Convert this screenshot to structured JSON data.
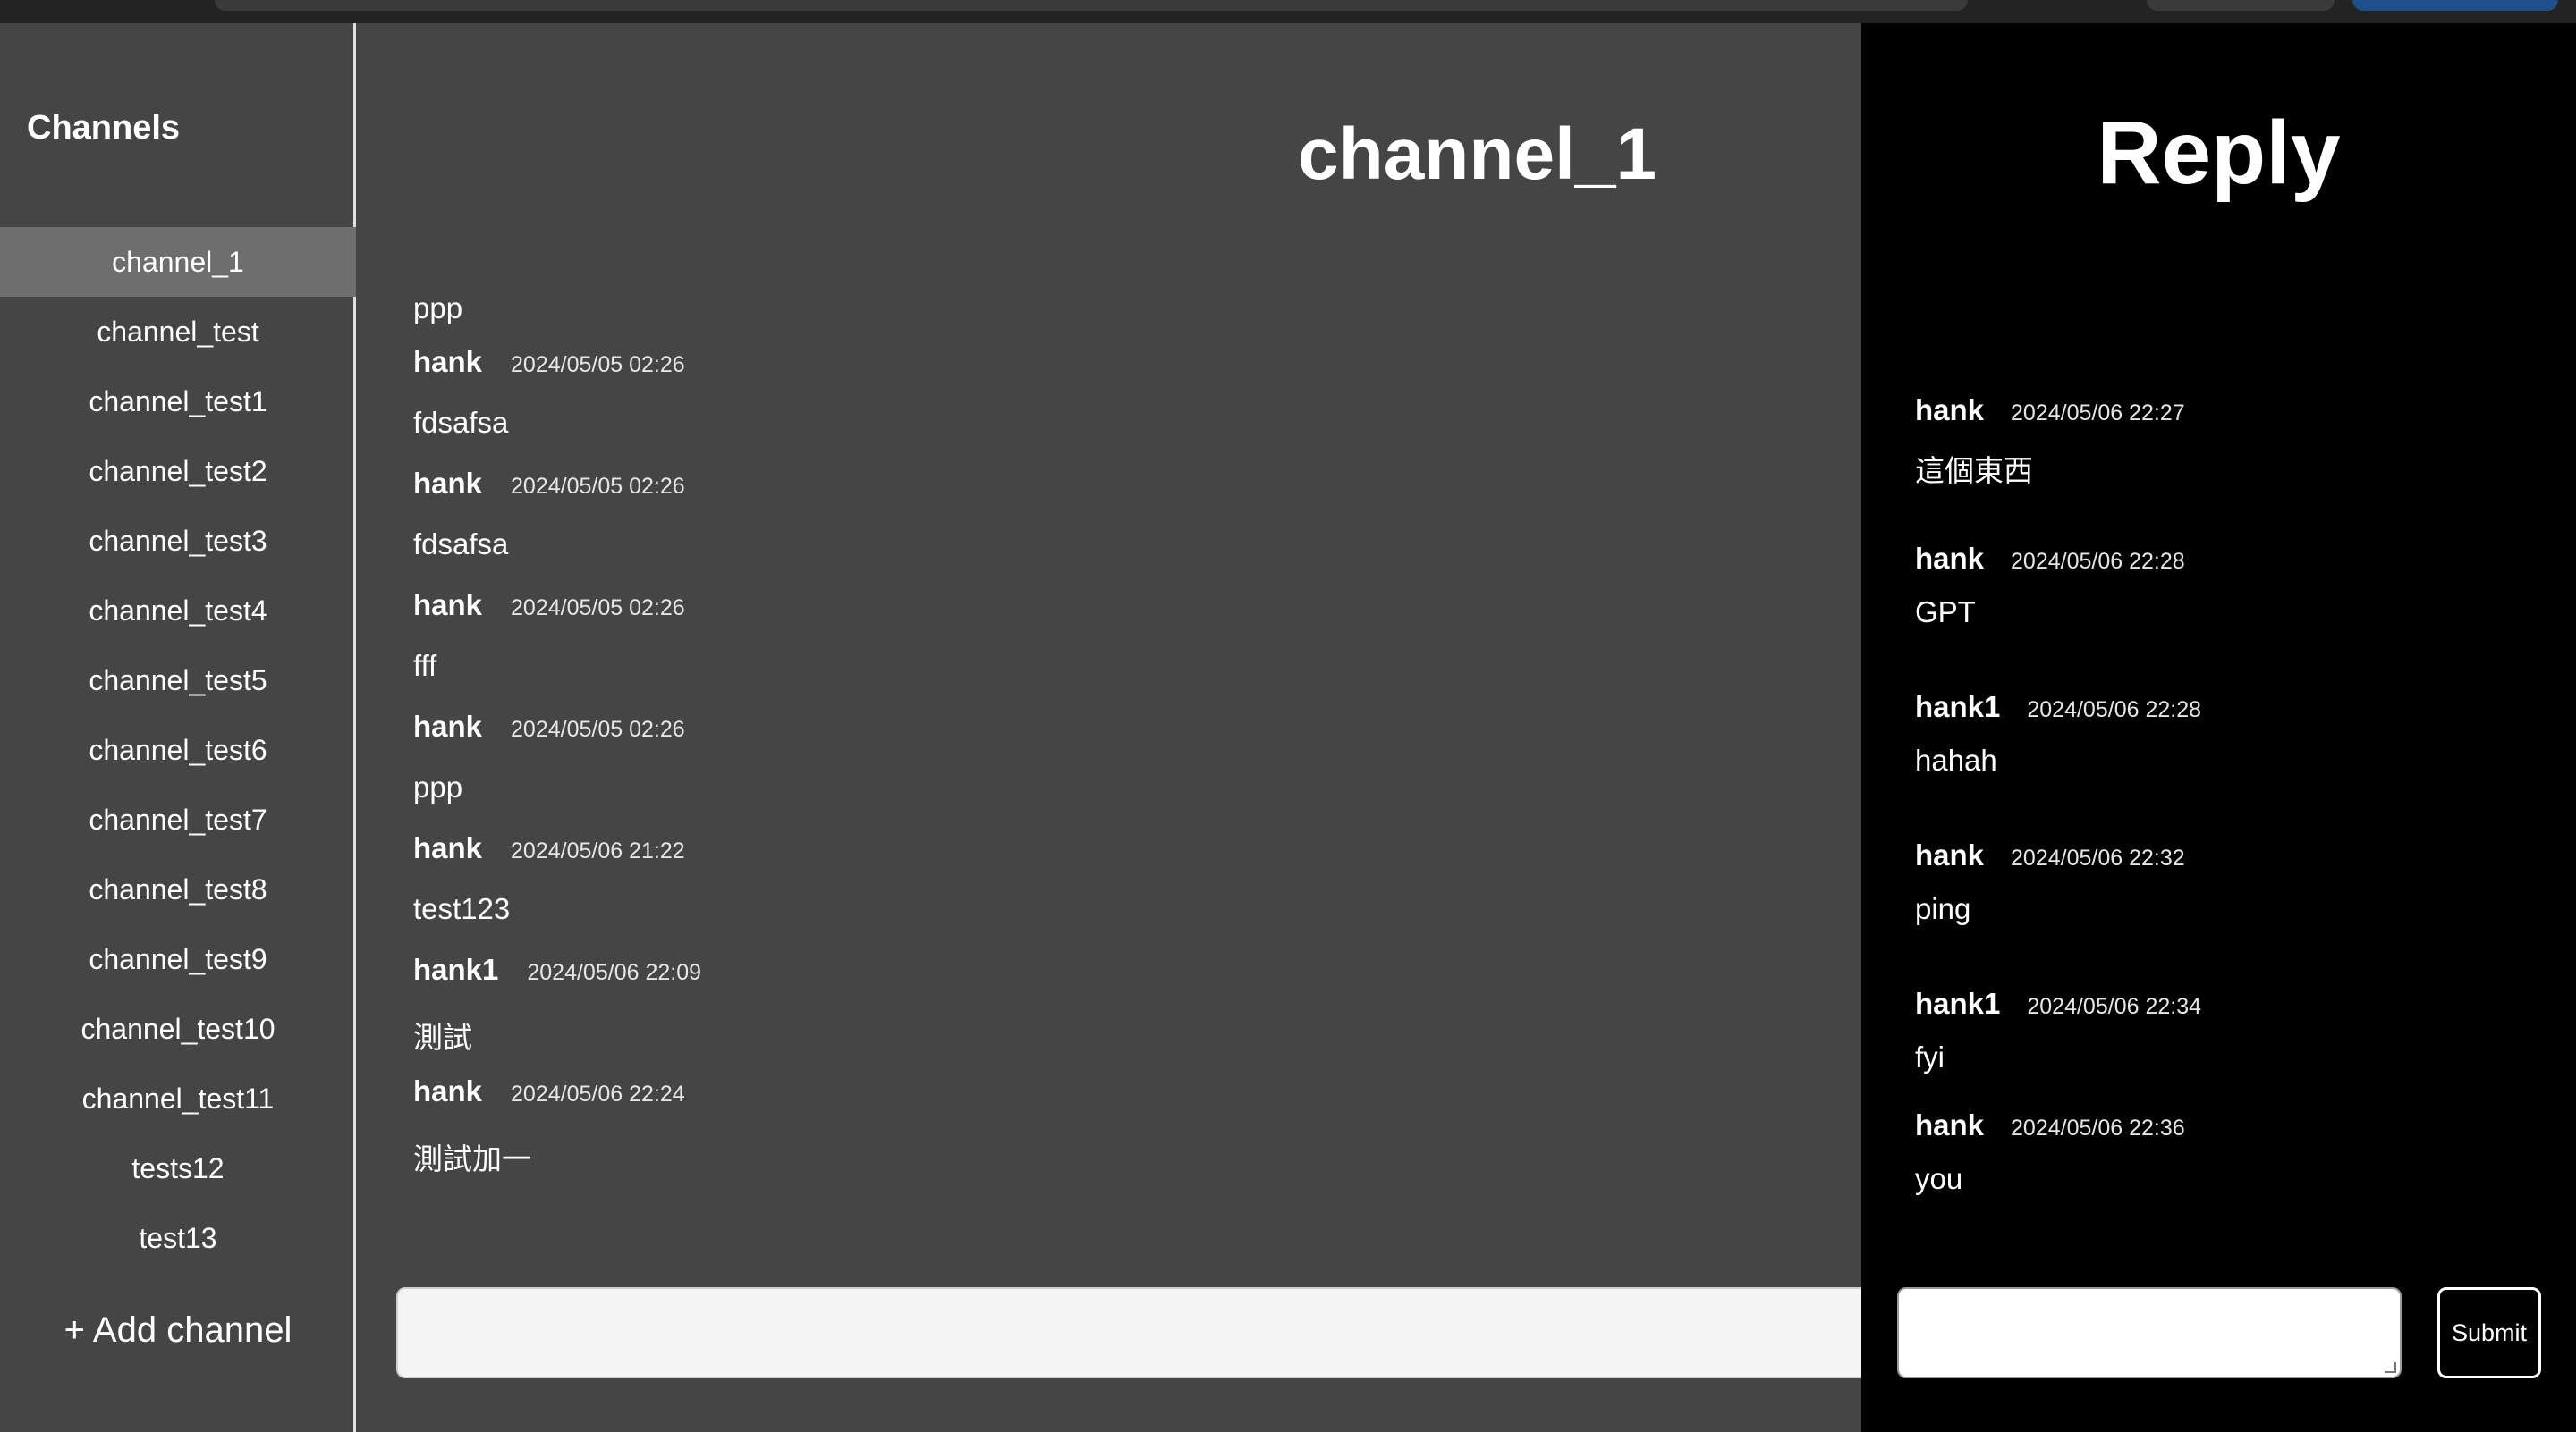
{
  "sidebar": {
    "title": "Channels",
    "add_label": "+ Add channel",
    "channels": [
      {
        "label": "channel_1",
        "active": true
      },
      {
        "label": "channel_test"
      },
      {
        "label": "channel_test1"
      },
      {
        "label": "channel_test2"
      },
      {
        "label": "channel_test3"
      },
      {
        "label": "channel_test4"
      },
      {
        "label": "channel_test5"
      },
      {
        "label": "channel_test6"
      },
      {
        "label": "channel_test7"
      },
      {
        "label": "channel_test8"
      },
      {
        "label": "channel_test9"
      },
      {
        "label": "channel_test10"
      },
      {
        "label": "channel_test11"
      },
      {
        "label": "tests12"
      },
      {
        "label": "test13"
      }
    ]
  },
  "main": {
    "title": "channel_1",
    "first_message_text": "ppp",
    "messages": [
      {
        "user": "hank",
        "time": "2024/05/05 02:26",
        "text": "fdsafsa"
      },
      {
        "user": "hank",
        "time": "2024/05/05 02:26",
        "text": "fdsafsa"
      },
      {
        "user": "hank",
        "time": "2024/05/05 02:26",
        "text": "fff"
      },
      {
        "user": "hank",
        "time": "2024/05/05 02:26",
        "text": "ppp"
      },
      {
        "user": "hank",
        "time": "2024/05/06 21:22",
        "text": "test123"
      },
      {
        "user": "hank1",
        "time": "2024/05/06 22:09",
        "text": "測試"
      },
      {
        "user": "hank",
        "time": "2024/05/06 22:24",
        "text": "測試加一"
      }
    ],
    "input_value": ""
  },
  "reply": {
    "title": "Reply",
    "items": [
      {
        "user": "hank",
        "time": "2024/05/06 22:27",
        "text": "這個東西"
      },
      {
        "user": "hank",
        "time": "2024/05/06 22:28",
        "text": "GPT"
      },
      {
        "user": "hank1",
        "time": "2024/05/06 22:28",
        "text": "hahah"
      },
      {
        "user": "hank",
        "time": "2024/05/06 22:32",
        "text": "ping"
      },
      {
        "user": "hank1",
        "time": "2024/05/06 22:34",
        "text": "fyi"
      },
      {
        "user": "hank",
        "time": "2024/05/06 22:36",
        "text": "you"
      }
    ],
    "input_value": "",
    "submit_label": "Submit"
  },
  "colors": {
    "panel": "#454545",
    "active_channel": "#6e6e6e",
    "reply_bg": "#000000",
    "text": "#ffffff"
  }
}
